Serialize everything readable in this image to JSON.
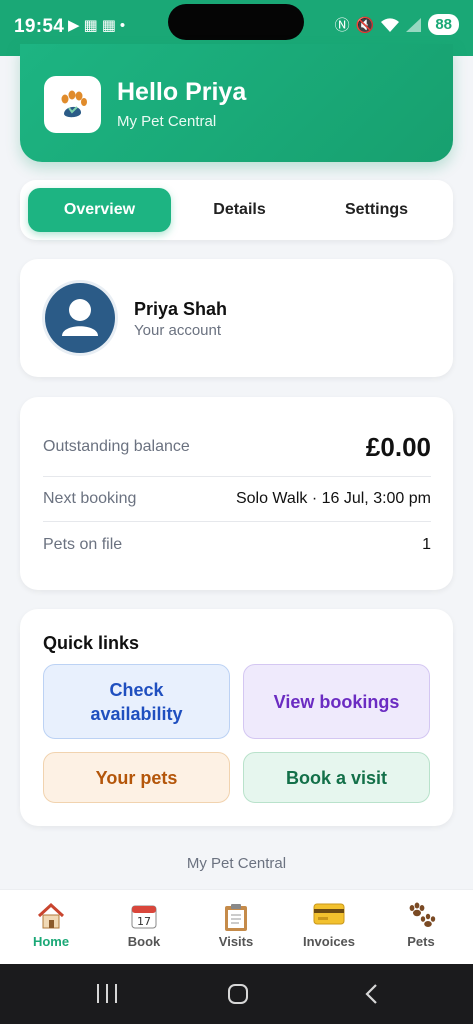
{
  "status": {
    "time": "19:54",
    "battery": "88"
  },
  "header": {
    "greeting": "Hello Priya",
    "app_name": "My Pet Central"
  },
  "tabs": [
    {
      "label": "Overview",
      "active": true
    },
    {
      "label": "Details",
      "active": false
    },
    {
      "label": "Settings",
      "active": false
    }
  ],
  "account": {
    "name": "Priya Shah",
    "subtitle": "Your account"
  },
  "summary": {
    "balance_label": "Outstanding balance",
    "balance_value": "£0.00",
    "booking_label": "Next booking",
    "booking_value": "Solo Walk · 16 Jul, 3:00 pm",
    "pets_label": "Pets on file",
    "pets_value": "1"
  },
  "quick_links": {
    "title": "Quick links",
    "check_availability": "Check availability",
    "view_bookings": "View bookings",
    "your_pets": "Your pets",
    "book_visit": "Book a visit"
  },
  "footer": {
    "text": "My Pet Central"
  },
  "nav": [
    {
      "label": "Home",
      "icon": "house-icon",
      "active": true
    },
    {
      "label": "Book",
      "icon": "calendar-icon",
      "active": false
    },
    {
      "label": "Visits",
      "icon": "clipboard-icon",
      "active": false
    },
    {
      "label": "Invoices",
      "icon": "credit-card-icon",
      "active": false
    },
    {
      "label": "Pets",
      "icon": "paw-prints-icon",
      "active": false
    }
  ],
  "colors": {
    "accent": "#1db482",
    "avatar": "#2b5b87"
  }
}
